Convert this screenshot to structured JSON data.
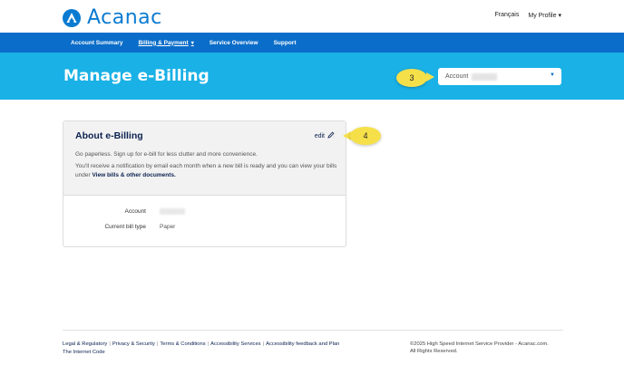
{
  "header": {
    "brand": "Acanac",
    "language_link": "Français",
    "profile_label": "My Profile"
  },
  "nav": {
    "items": [
      {
        "label": "Account Summary"
      },
      {
        "label": "Billing & Payment"
      },
      {
        "label": "Service Overview"
      },
      {
        "label": "Support"
      }
    ]
  },
  "hero": {
    "title": "Manage e-Billing",
    "account_select_label": "Account"
  },
  "callouts": {
    "step3": "3",
    "step4": "4"
  },
  "card": {
    "title": "About e-Billing",
    "edit_label": "edit",
    "text1": "Go paperless. Sign up for e-bill for less clutter and more convenience.",
    "text2_prefix": "You'll receive a notification by email each month when a new bill is ready and you can view your bills under ",
    "text2_link": "View bills & other documents.",
    "details": [
      {
        "label": "Account",
        "value": ""
      },
      {
        "label": "Current bill type",
        "value": "Paper"
      }
    ]
  },
  "footer": {
    "links": [
      "Legal & Regulatory",
      "Privacy & Security",
      "Terms & Conditions",
      "Accessibility Services",
      "Accessibility feedback and Plan",
      "The Internet Code"
    ],
    "copyright_line1": "©2025 High Speed Internet Service Provider - Acanac.com.",
    "copyright_line2": "All Rights Reserved."
  },
  "colors": {
    "brand_blue": "#0a7bd1",
    "nav_blue": "#0a6dc9",
    "hero_cyan": "#1ab1e6",
    "callout_yellow": "#f6e04a",
    "navy_text": "#0b2150"
  }
}
